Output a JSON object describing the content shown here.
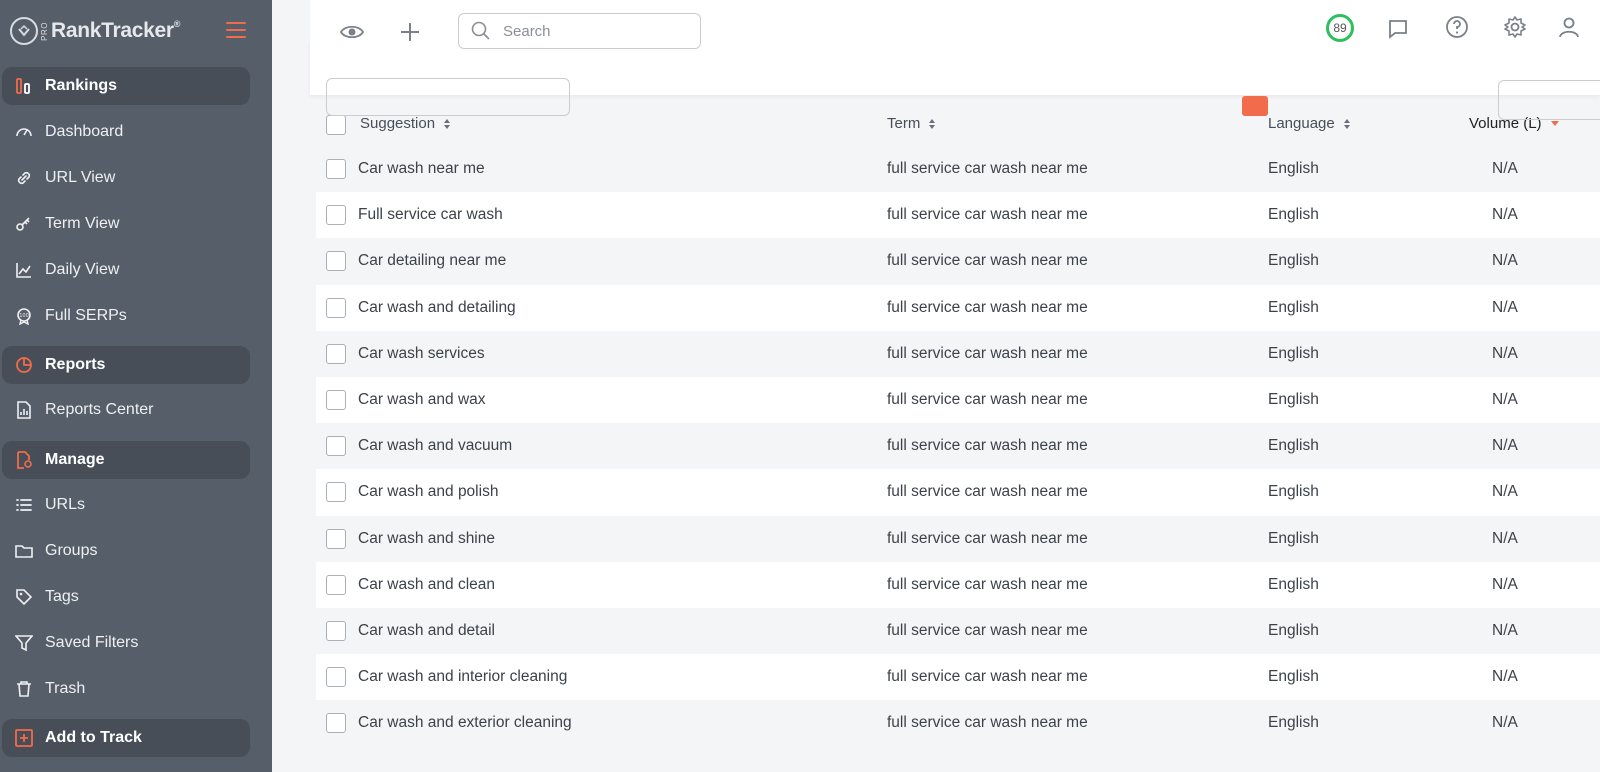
{
  "app": {
    "logo_text": "RankTracker",
    "logo_pro": "PRO",
    "logo_reg": "®"
  },
  "sidebar": {
    "items": [
      {
        "label": "Rankings",
        "icon": "rankings-icon",
        "section": true
      },
      {
        "label": "Dashboard",
        "icon": "dashboard-gauge-icon"
      },
      {
        "label": "URL View",
        "icon": "link-icon"
      },
      {
        "label": "Term View",
        "icon": "key-icon"
      },
      {
        "label": "Daily View",
        "icon": "line-chart-icon"
      },
      {
        "label": "Full SERPs",
        "icon": "serp-badge-icon"
      },
      {
        "label": "Reports",
        "icon": "pie-chart-icon",
        "section": true
      },
      {
        "label": "Reports Center",
        "icon": "report-document-icon"
      },
      {
        "label": "Manage",
        "icon": "manage-file-gear-icon",
        "section": true
      },
      {
        "label": "URLs",
        "icon": "list-icon"
      },
      {
        "label": "Groups",
        "icon": "folder-icon"
      },
      {
        "label": "Tags",
        "icon": "tag-icon"
      },
      {
        "label": "Saved Filters",
        "icon": "filter-icon"
      },
      {
        "label": "Trash",
        "icon": "trash-icon"
      },
      {
        "label": "Add to Track",
        "icon": "add-square-icon",
        "section": true
      }
    ]
  },
  "topbar": {
    "search_placeholder": "Search",
    "score": "89"
  },
  "table": {
    "headers": {
      "suggestion": "Suggestion",
      "term": "Term",
      "language": "Language",
      "volume": "Volume (L)"
    },
    "rows": [
      {
        "suggestion": "Car wash near me",
        "term": "full service car wash near me",
        "language": "English",
        "volume": "N/A"
      },
      {
        "suggestion": "Full service car wash",
        "term": "full service car wash near me",
        "language": "English",
        "volume": "N/A"
      },
      {
        "suggestion": "Car detailing near me",
        "term": "full service car wash near me",
        "language": "English",
        "volume": "N/A"
      },
      {
        "suggestion": "Car wash and detailing",
        "term": "full service car wash near me",
        "language": "English",
        "volume": "N/A"
      },
      {
        "suggestion": "Car wash services",
        "term": "full service car wash near me",
        "language": "English",
        "volume": "N/A"
      },
      {
        "suggestion": "Car wash and wax",
        "term": "full service car wash near me",
        "language": "English",
        "volume": "N/A"
      },
      {
        "suggestion": "Car wash and vacuum",
        "term": "full service car wash near me",
        "language": "English",
        "volume": "N/A"
      },
      {
        "suggestion": "Car wash and polish",
        "term": "full service car wash near me",
        "language": "English",
        "volume": "N/A"
      },
      {
        "suggestion": "Car wash and shine",
        "term": "full service car wash near me",
        "language": "English",
        "volume": "N/A"
      },
      {
        "suggestion": "Car wash and clean",
        "term": "full service car wash near me",
        "language": "English",
        "volume": "N/A"
      },
      {
        "suggestion": "Car wash and detail",
        "term": "full service car wash near me",
        "language": "English",
        "volume": "N/A"
      },
      {
        "suggestion": "Car wash and interior cleaning",
        "term": "full service car wash near me",
        "language": "English",
        "volume": "N/A"
      },
      {
        "suggestion": "Car wash and exterior cleaning",
        "term": "full service car wash near me",
        "language": "English",
        "volume": "N/A"
      }
    ]
  },
  "colors": {
    "accent": "#f26b4a",
    "sidebar": "#565e6a",
    "section": "#474e58",
    "score_ring": "#2fbf5f"
  }
}
